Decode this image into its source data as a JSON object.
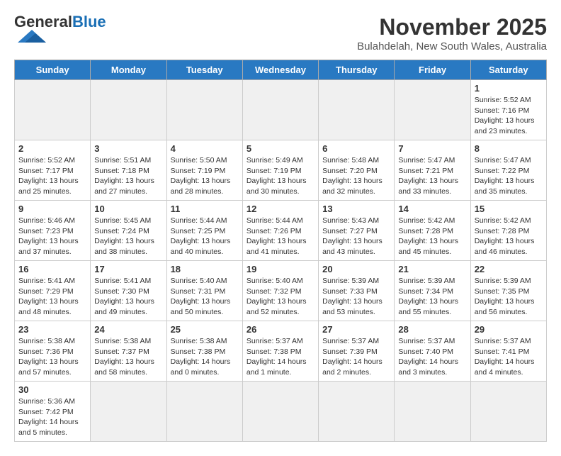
{
  "header": {
    "logo_general": "General",
    "logo_blue": "Blue",
    "month": "November 2025",
    "location": "Bulahdelah, New South Wales, Australia"
  },
  "weekdays": [
    "Sunday",
    "Monday",
    "Tuesday",
    "Wednesday",
    "Thursday",
    "Friday",
    "Saturday"
  ],
  "days": {
    "1": {
      "sunrise": "5:52 AM",
      "sunset": "7:16 PM",
      "daylight": "13 hours and 23 minutes."
    },
    "2": {
      "sunrise": "5:52 AM",
      "sunset": "7:17 PM",
      "daylight": "13 hours and 25 minutes."
    },
    "3": {
      "sunrise": "5:51 AM",
      "sunset": "7:18 PM",
      "daylight": "13 hours and 27 minutes."
    },
    "4": {
      "sunrise": "5:50 AM",
      "sunset": "7:19 PM",
      "daylight": "13 hours and 28 minutes."
    },
    "5": {
      "sunrise": "5:49 AM",
      "sunset": "7:19 PM",
      "daylight": "13 hours and 30 minutes."
    },
    "6": {
      "sunrise": "5:48 AM",
      "sunset": "7:20 PM",
      "daylight": "13 hours and 32 minutes."
    },
    "7": {
      "sunrise": "5:47 AM",
      "sunset": "7:21 PM",
      "daylight": "13 hours and 33 minutes."
    },
    "8": {
      "sunrise": "5:47 AM",
      "sunset": "7:22 PM",
      "daylight": "13 hours and 35 minutes."
    },
    "9": {
      "sunrise": "5:46 AM",
      "sunset": "7:23 PM",
      "daylight": "13 hours and 37 minutes."
    },
    "10": {
      "sunrise": "5:45 AM",
      "sunset": "7:24 PM",
      "daylight": "13 hours and 38 minutes."
    },
    "11": {
      "sunrise": "5:44 AM",
      "sunset": "7:25 PM",
      "daylight": "13 hours and 40 minutes."
    },
    "12": {
      "sunrise": "5:44 AM",
      "sunset": "7:26 PM",
      "daylight": "13 hours and 41 minutes."
    },
    "13": {
      "sunrise": "5:43 AM",
      "sunset": "7:27 PM",
      "daylight": "13 hours and 43 minutes."
    },
    "14": {
      "sunrise": "5:42 AM",
      "sunset": "7:28 PM",
      "daylight": "13 hours and 45 minutes."
    },
    "15": {
      "sunrise": "5:42 AM",
      "sunset": "7:28 PM",
      "daylight": "13 hours and 46 minutes."
    },
    "16": {
      "sunrise": "5:41 AM",
      "sunset": "7:29 PM",
      "daylight": "13 hours and 48 minutes."
    },
    "17": {
      "sunrise": "5:41 AM",
      "sunset": "7:30 PM",
      "daylight": "13 hours and 49 minutes."
    },
    "18": {
      "sunrise": "5:40 AM",
      "sunset": "7:31 PM",
      "daylight": "13 hours and 50 minutes."
    },
    "19": {
      "sunrise": "5:40 AM",
      "sunset": "7:32 PM",
      "daylight": "13 hours and 52 minutes."
    },
    "20": {
      "sunrise": "5:39 AM",
      "sunset": "7:33 PM",
      "daylight": "13 hours and 53 minutes."
    },
    "21": {
      "sunrise": "5:39 AM",
      "sunset": "7:34 PM",
      "daylight": "13 hours and 55 minutes."
    },
    "22": {
      "sunrise": "5:39 AM",
      "sunset": "7:35 PM",
      "daylight": "13 hours and 56 minutes."
    },
    "23": {
      "sunrise": "5:38 AM",
      "sunset": "7:36 PM",
      "daylight": "13 hours and 57 minutes."
    },
    "24": {
      "sunrise": "5:38 AM",
      "sunset": "7:37 PM",
      "daylight": "13 hours and 58 minutes."
    },
    "25": {
      "sunrise": "5:38 AM",
      "sunset": "7:38 PM",
      "daylight": "14 hours and 0 minutes."
    },
    "26": {
      "sunrise": "5:37 AM",
      "sunset": "7:38 PM",
      "daylight": "14 hours and 1 minute."
    },
    "27": {
      "sunrise": "5:37 AM",
      "sunset": "7:39 PM",
      "daylight": "14 hours and 2 minutes."
    },
    "28": {
      "sunrise": "5:37 AM",
      "sunset": "7:40 PM",
      "daylight": "14 hours and 3 minutes."
    },
    "29": {
      "sunrise": "5:37 AM",
      "sunset": "7:41 PM",
      "daylight": "14 hours and 4 minutes."
    },
    "30": {
      "sunrise": "5:36 AM",
      "sunset": "7:42 PM",
      "daylight": "14 hours and 5 minutes."
    }
  }
}
